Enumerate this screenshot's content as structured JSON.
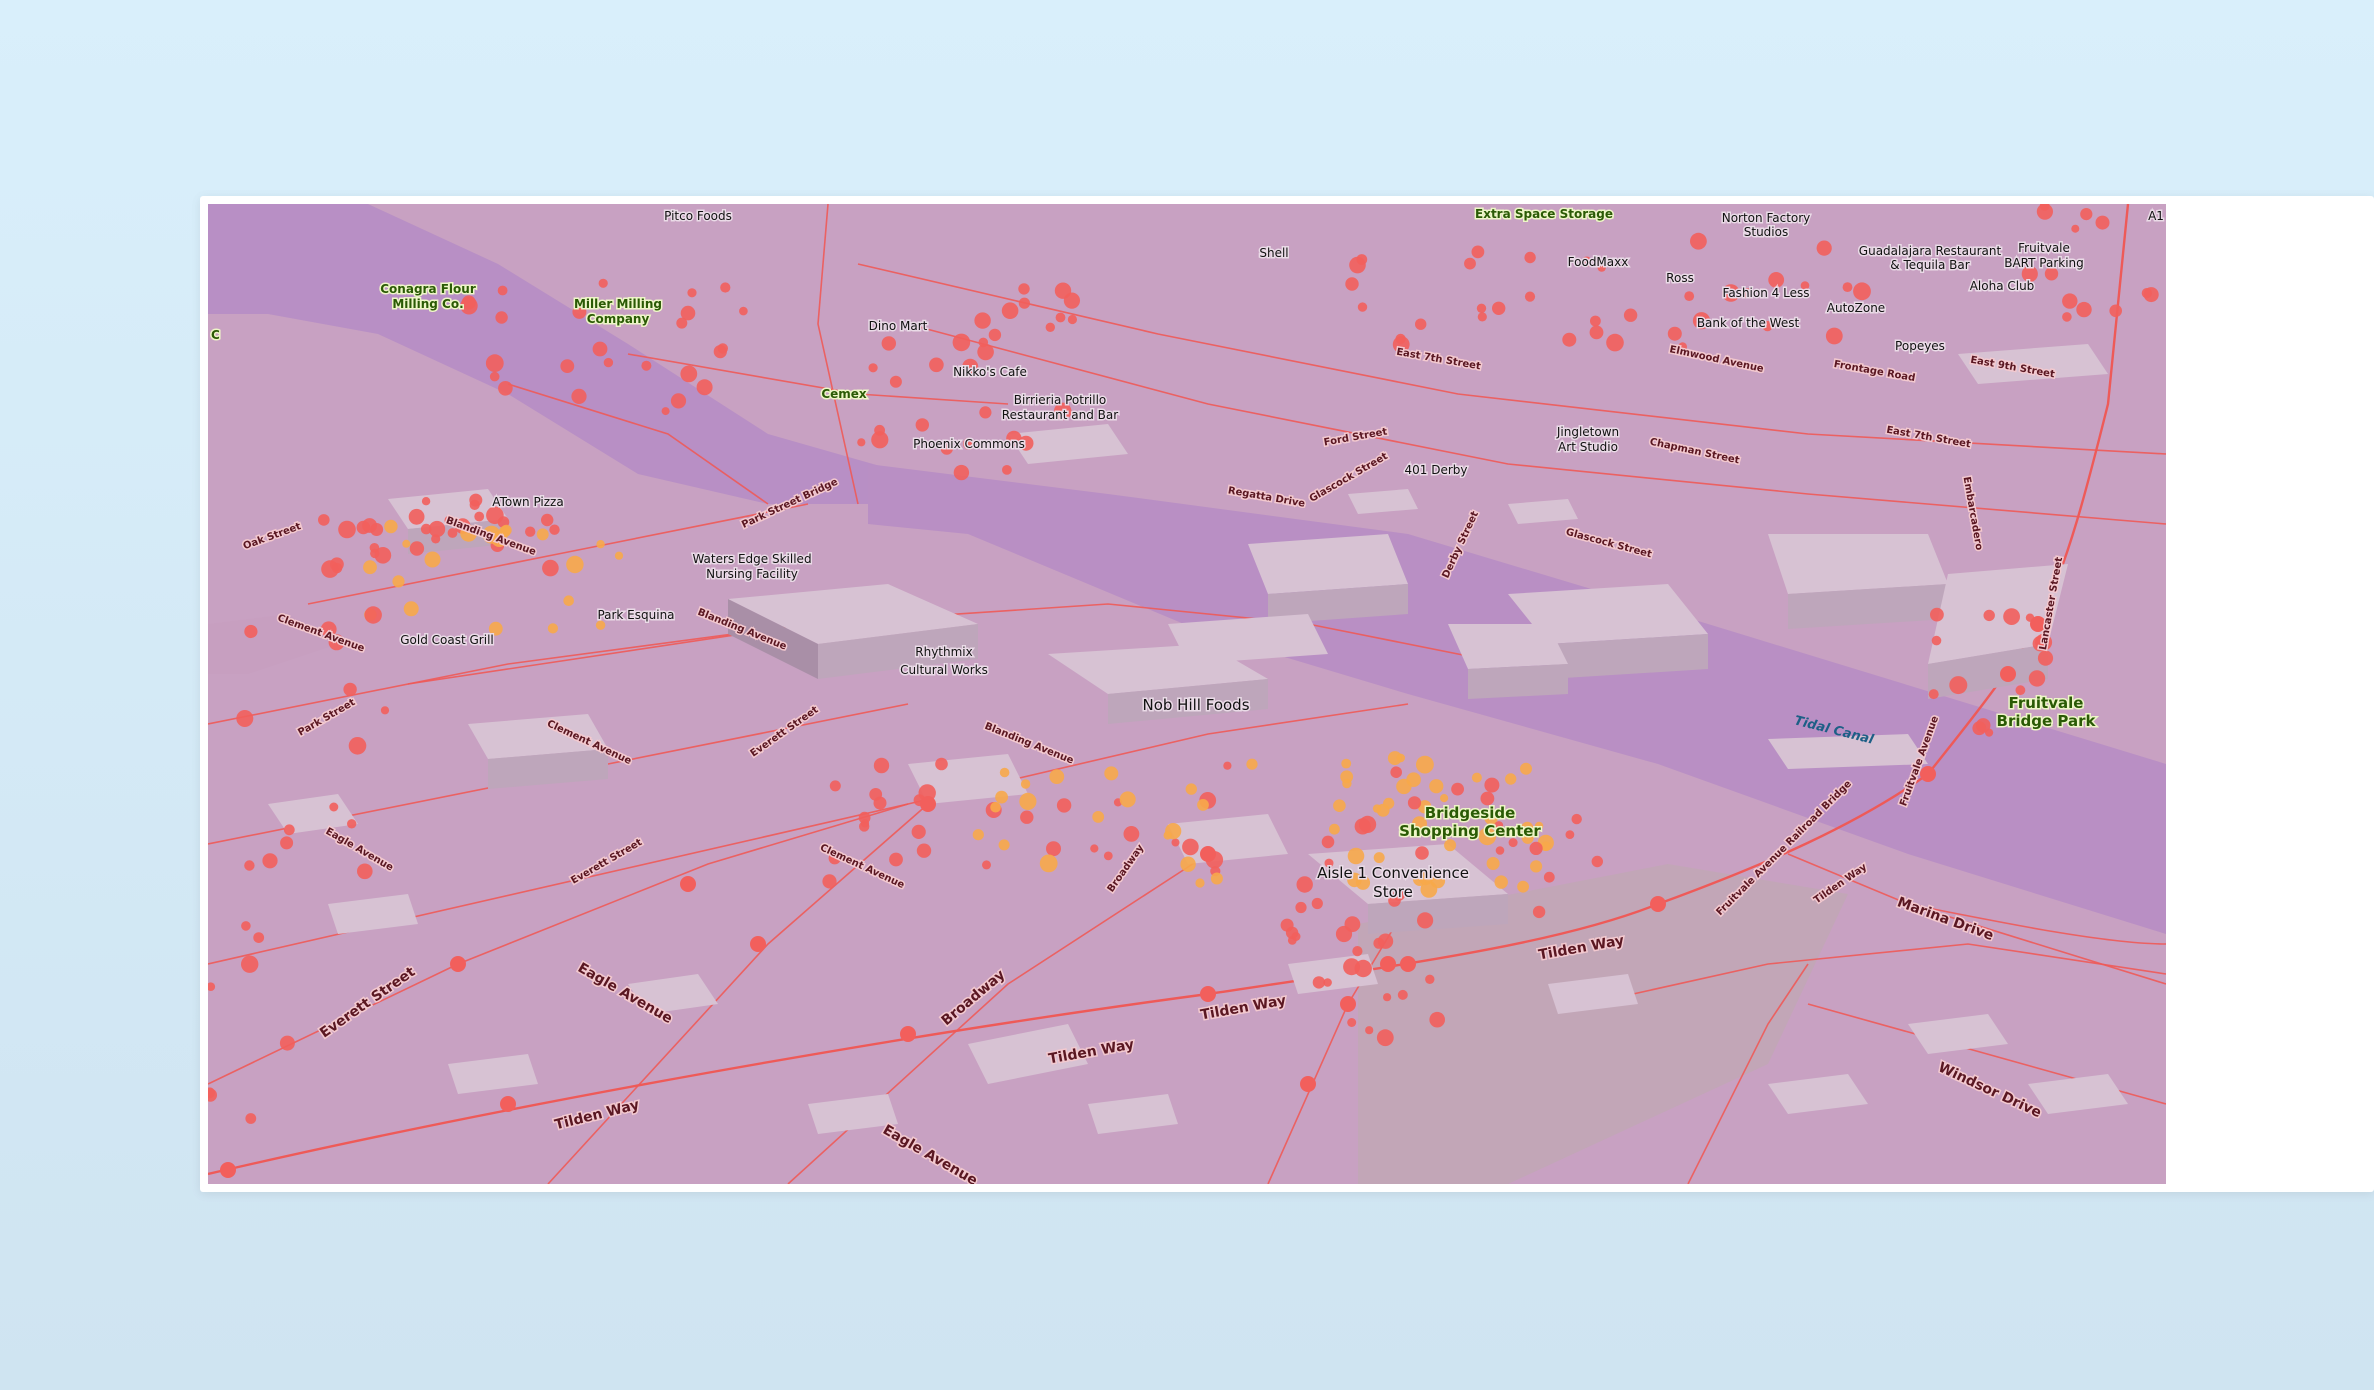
{
  "colors": {
    "background": "#d9effb",
    "land": "#c8a1c2",
    "water": "#b98fc4",
    "building": "#d7c2d3",
    "road": "#ee5a58",
    "poi_red": "#f25f5c",
    "poi_orange": "#f7a84a",
    "poi_olive": "#b59c74"
  },
  "labels": {
    "pitco": "Pitco Foods",
    "extra_space": "Extra Space Storage",
    "norton_1": "Norton Factory",
    "norton_2": "Studios",
    "a1": "A1",
    "conagra_1": "Conagra Flour",
    "conagra_2": "Milling Co.",
    "miller_1": "Miller Milling",
    "miller_2": "Company",
    "shell": "Shell",
    "foodmaxx": "FoodMaxx",
    "ross": "Ross",
    "fashion4less": "Fashion 4 Less",
    "bank_west": "Bank of the West",
    "autozone": "AutoZone",
    "guadalajara_1": "Guadalajara Restaurant",
    "guadalajara_2": "& Tequila Bar",
    "fruitvale_bart_1": "Fruitvale",
    "fruitvale_bart_2": "BART Parking",
    "aloha": "Aloha Club",
    "popeyes": "Popeyes",
    "dino_mart": "Dino Mart",
    "nikkos": "Nikko's Cafe",
    "birrieria_1": "Birrieria Potrillo",
    "birrieria_2": "Restaurant and Bar",
    "cemex": "Cemex",
    "phoenix": "Phoenix Commons",
    "jingletown_1": "Jingletown",
    "jingletown_2": "Art Studio",
    "derby401": "401 Derby",
    "atown": "ATown Pizza",
    "waters_edge_1": "Waters Edge Skilled",
    "waters_edge_2": "Nursing Facility",
    "park_esquina": "Park Esquina",
    "gold_coast": "Gold Coast Grill",
    "rhythmix_1": "Rhythmix",
    "rhythmix_2": "Cultural Works",
    "nob_hill": "Nob Hill Foods",
    "tidal_canal": "Tidal Canal",
    "fruitvale_park_1": "Fruitvale",
    "fruitvale_park_2": "Bridge Park",
    "bridgeside_1": "Bridgeside",
    "bridgeside_2": "Shopping Center",
    "aisle1_1": "Aisle 1 Convenience",
    "aisle1_2": "Store",
    "edge_c": "C"
  },
  "streets": {
    "tilden_1": "Tilden Way",
    "tilden_2": "Tilden Way",
    "tilden_3": "Tilden Way",
    "tilden_4": "Tilden Way",
    "tilden_5": "Tilden Way",
    "eagle_1": "Eagle Avenue",
    "eagle_2": "Eagle Avenue",
    "eagle_3": "Eagle Avenue",
    "everett_1": "Everett Street",
    "everett_2": "Everett Street",
    "everett_3": "Everett Street",
    "broadway_1": "Broadway",
    "broadway_2": "Broadway",
    "clement_1": "Clement Avenue",
    "clement_2": "Clement Avenue",
    "clement_3": "Clement Avenue",
    "blanding_1": "Blanding Avenue",
    "blanding_2": "Blanding Avenue",
    "blanding_3": "Blanding Avenue",
    "park_st": "Park Street",
    "oak_st": "Oak Street",
    "park_bridge": "Park Street Bridge",
    "fruitvale_ave_bridge": "Fruitvale Avenue Railroad Bridge",
    "fruitvale_ave": "Fruitvale Avenue",
    "marina": "Marina Drive",
    "windsor": "Windsor Drive",
    "derby": "Derby Street",
    "glascock_1": "Glascock Street",
    "glascock_2": "Glascock Street",
    "regatta": "Regatta Drive",
    "ford": "Ford Street",
    "east7": "East 7th Street",
    "east7b": "East 7th Street",
    "chapman": "Chapman Street",
    "elmwood": "Elmwood Avenue",
    "frontage": "Frontage Road",
    "lancaster": "Lancaster Street",
    "embarcadero": "Embarcadero",
    "ninth": "East 9th Street"
  }
}
